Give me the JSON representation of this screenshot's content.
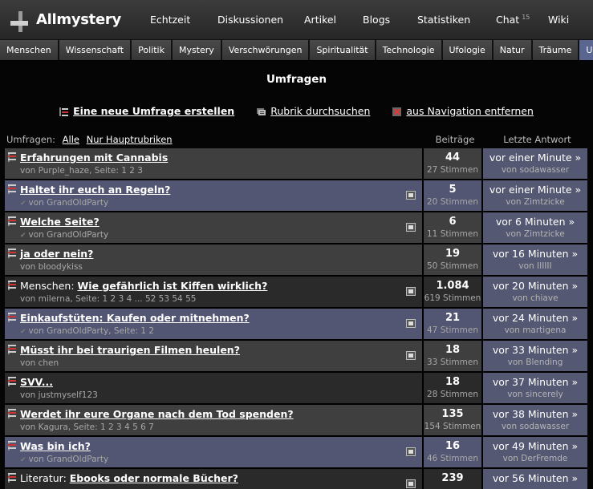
{
  "app": {
    "logo_text": "Allmystery"
  },
  "topnav": [
    {
      "label": "Echtzeit",
      "name": "topnav-echtzeit"
    },
    {
      "label": "Diskussionen",
      "name": "topnav-diskussionen"
    },
    {
      "label": "Artikel",
      "name": "topnav-artikel"
    },
    {
      "label": "Blogs",
      "name": "topnav-blogs"
    },
    {
      "label": "Statistiken",
      "name": "topnav-statistiken"
    },
    {
      "label": "Chat",
      "name": "topnav-chat",
      "badge": "15"
    },
    {
      "label": "Wiki",
      "name": "topnav-wiki"
    }
  ],
  "categories": [
    "Menschen",
    "Wissenschaft",
    "Politik",
    "Mystery",
    "Verschwörungen",
    "Spiritualität",
    "Technologie",
    "Ufologie",
    "Natur",
    "Träume",
    "Umfragen"
  ],
  "active_category": "Umfragen",
  "page_title": "Umfragen",
  "actions": {
    "new_poll": "Eine neue Umfrage erstellen",
    "search": "Rubrik durchsuchen",
    "remove_nav": "aus Navigation entfernen"
  },
  "table_header": {
    "filter_label": "Umfragen:",
    "filter_all": "Alle",
    "filter_main": "Nur Hauptrubriken",
    "col_posts": "Beiträge",
    "col_last": "Letzte Antwort"
  },
  "rows": [
    {
      "style": "dark",
      "prefix": "",
      "title": "Erfahrungen mit Cannabis",
      "sub": "von Purple_haze, Seite: 1 2 3",
      "check": false,
      "poll_icon": false,
      "posts": "44",
      "votes": "27 Stimmen",
      "last": "vor einer Minute »",
      "last_by": "von sodawasser"
    },
    {
      "style": "blue",
      "prefix": "",
      "title": "Haltet ihr euch an Regeln?",
      "sub": "von GrandOldParty",
      "check": true,
      "poll_icon": true,
      "posts": "5",
      "votes": "20 Stimmen",
      "last": "vor einer Minute »",
      "last_by": "von Zimtzicke"
    },
    {
      "style": "dark",
      "prefix": "",
      "title": "Welche Seite?",
      "sub": "von GrandOldParty",
      "check": true,
      "poll_icon": true,
      "posts": "6",
      "votes": "11 Stimmen",
      "last": "vor 6 Minuten »",
      "last_by": "von Zimtzicke"
    },
    {
      "style": "dark",
      "prefix": "",
      "title": "ja oder nein?",
      "sub": "von bloodykiss",
      "check": false,
      "poll_icon": false,
      "posts": "19",
      "votes": "50 Stimmen",
      "last": "vor 16 Minuten »",
      "last_by": "von IIIIII"
    },
    {
      "style": "black",
      "prefix": "Menschen: ",
      "title": "Wie gefährlich ist Kiffen wirklich?",
      "sub": "von milerna, Seite: 1 2 3 4 ... 52 53 54 55",
      "check": false,
      "poll_icon": true,
      "posts": "1.084",
      "votes": "619 Stimmen",
      "last": "vor 20 Minuten »",
      "last_by": "von chiave"
    },
    {
      "style": "blue",
      "prefix": "",
      "title": "Einkaufstüten: Kaufen oder mitnehmen?",
      "sub": "von GrandOldParty, Seite: 1 2",
      "check": true,
      "poll_icon": true,
      "posts": "21",
      "votes": "47 Stimmen",
      "last": "vor 24 Minuten »",
      "last_by": "von martigena"
    },
    {
      "style": "dark",
      "prefix": "",
      "title": "Müsst ihr bei traurigen Filmen heulen?",
      "sub": "von chen",
      "check": false,
      "poll_icon": true,
      "posts": "18",
      "votes": "33 Stimmen",
      "last": "vor 33 Minuten »",
      "last_by": "von Blending"
    },
    {
      "style": "black",
      "prefix": "",
      "title": "SVV...",
      "sub": "von justmyself123",
      "check": false,
      "poll_icon": false,
      "posts": "18",
      "votes": "28 Stimmen",
      "last": "vor 37 Minuten »",
      "last_by": "von sincerely"
    },
    {
      "style": "dark",
      "prefix": "",
      "title": "Werdet ihr eure Organe nach dem Tod spenden?",
      "sub": "von Kagura, Seite: 1 2 3 4 5 6 7",
      "check": false,
      "poll_icon": false,
      "posts": "135",
      "votes": "154 Stimmen",
      "last": "vor 38 Minuten »",
      "last_by": "von sodawasser"
    },
    {
      "style": "blue",
      "prefix": "",
      "title": "Was bin ich?",
      "sub": "von GrandOldParty",
      "check": true,
      "poll_icon": true,
      "posts": "16",
      "votes": "46 Stimmen",
      "last": "vor 49 Minuten »",
      "last_by": "von DerFremde"
    },
    {
      "style": "black",
      "prefix": "Literatur: ",
      "title": "Ebooks oder normale Bücher?",
      "sub": "",
      "check": false,
      "poll_icon": true,
      "posts": "239",
      "votes": "",
      "last": "vor 56 Minuten »",
      "last_by": ""
    }
  ]
}
